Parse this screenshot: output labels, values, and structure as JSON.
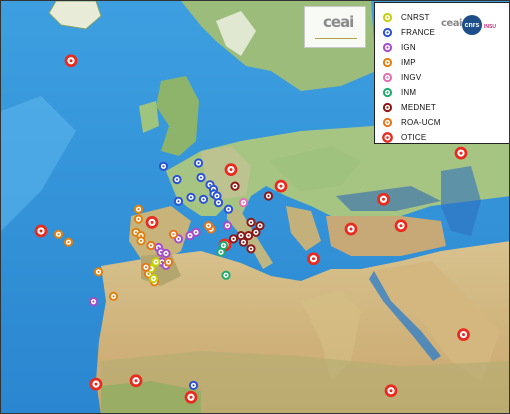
{
  "map_image": {
    "logo": {
      "text": "ceai",
      "subtitle": ""
    },
    "legend": {
      "items": [
        {
          "label": "CNRST",
          "color": "#c6cf0e"
        },
        {
          "label": "FRANCE",
          "color": "#2a52d3"
        },
        {
          "label": "IGN",
          "color": "#a44ccc"
        },
        {
          "label": "IMP",
          "color": "#e0800f"
        },
        {
          "label": "INGV",
          "color": "#e46fb5"
        },
        {
          "label": "INM",
          "color": "#1faa6d"
        },
        {
          "label": "MEDNET",
          "color": "#8c1717"
        },
        {
          "label": "ROA-UCM",
          "color": "#e6761c"
        },
        {
          "label": "OTICE",
          "color": "#e82a1f"
        }
      ],
      "partner_logos": {
        "ceai": "ceai",
        "cnrs": "cnrs",
        "insu": "INSU"
      }
    },
    "stations": [
      {
        "network": "OTICE",
        "lon": -22.0,
        "lat": 64.5
      },
      {
        "network": "OTICE",
        "lon": 10.0,
        "lat": 48.0
      },
      {
        "network": "OTICE",
        "lon": -28.0,
        "lat": 38.7
      },
      {
        "network": "OTICE",
        "lon": -5.8,
        "lat": 40.0
      },
      {
        "network": "OTICE",
        "lon": 8.8,
        "lat": 36.6
      },
      {
        "network": "OTICE",
        "lon": 20.0,
        "lat": 45.5
      },
      {
        "network": "OTICE",
        "lon": 26.5,
        "lat": 34.5
      },
      {
        "network": "OTICE",
        "lon": 40.5,
        "lat": 43.5
      },
      {
        "network": "OTICE",
        "lon": 34.0,
        "lat": 39.0
      },
      {
        "network": "OTICE",
        "lon": 44.0,
        "lat": 39.5
      },
      {
        "network": "OTICE",
        "lon": 56.0,
        "lat": 50.5
      },
      {
        "network": "OTICE",
        "lon": 56.5,
        "lat": 23.0
      },
      {
        "network": "OTICE",
        "lon": 42.0,
        "lat": 14.5
      },
      {
        "network": "OTICE",
        "lon": -17.0,
        "lat": 15.5
      },
      {
        "network": "OTICE",
        "lon": -9.0,
        "lat": 16.0
      },
      {
        "network": "OTICE",
        "lon": 2.0,
        "lat": 13.5
      },
      {
        "network": "FRANCE",
        "lon": -3.5,
        "lat": 48.5
      },
      {
        "network": "FRANCE",
        "lon": 3.5,
        "lat": 49.0
      },
      {
        "network": "FRANCE",
        "lon": -0.8,
        "lat": 46.5
      },
      {
        "network": "FRANCE",
        "lon": 4.0,
        "lat": 46.8
      },
      {
        "network": "FRANCE",
        "lon": 5.8,
        "lat": 45.7
      },
      {
        "network": "FRANCE",
        "lon": 6.5,
        "lat": 45.0
      },
      {
        "network": "FRANCE",
        "lon": 6.6,
        "lat": 44.3
      },
      {
        "network": "FRANCE",
        "lon": 7.2,
        "lat": 44.0
      },
      {
        "network": "FRANCE",
        "lon": 7.5,
        "lat": 43.0
      },
      {
        "network": "FRANCE",
        "lon": 4.5,
        "lat": 43.5
      },
      {
        "network": "FRANCE",
        "lon": 2.0,
        "lat": 43.8
      },
      {
        "network": "FRANCE",
        "lon": -0.5,
        "lat": 43.2
      },
      {
        "network": "FRANCE",
        "lon": 9.5,
        "lat": 42.0
      },
      {
        "network": "FRANCE",
        "lon": 2.5,
        "lat": 15.3
      },
      {
        "network": "IGN",
        "lon": 3.0,
        "lat": 38.5
      },
      {
        "network": "IGN",
        "lon": 1.8,
        "lat": 38.0
      },
      {
        "network": "IGN",
        "lon": -0.5,
        "lat": 37.5
      },
      {
        "network": "IGN",
        "lon": -4.5,
        "lat": 36.2
      },
      {
        "network": "IGN",
        "lon": -4.0,
        "lat": 35.5
      },
      {
        "network": "IGN",
        "lon": -3.0,
        "lat": 35.3
      },
      {
        "network": "IGN",
        "lon": -3.8,
        "lat": 34.0
      },
      {
        "network": "IGN",
        "lon": -3.0,
        "lat": 33.5
      },
      {
        "network": "IGN",
        "lon": -17.5,
        "lat": 28.0
      },
      {
        "network": "IGN",
        "lon": 9.3,
        "lat": 39.5
      },
      {
        "network": "IMP",
        "lon": -8.5,
        "lat": 42.0
      },
      {
        "network": "IMP",
        "lon": -8.5,
        "lat": 40.5
      },
      {
        "network": "IMP",
        "lon": -9.0,
        "lat": 38.5
      },
      {
        "network": "IMP",
        "lon": -8.0,
        "lat": 38.0
      },
      {
        "network": "IMP",
        "lon": -8.0,
        "lat": 37.2
      },
      {
        "network": "IMP",
        "lon": -24.5,
        "lat": 38.2
      },
      {
        "network": "IMP",
        "lon": -22.5,
        "lat": 37.0
      },
      {
        "network": "IMP",
        "lon": -16.5,
        "lat": 32.5
      },
      {
        "network": "IMP",
        "lon": -13.5,
        "lat": 28.8
      },
      {
        "network": "IMP",
        "lon": -6.5,
        "lat": 32.2
      },
      {
        "network": "IMP",
        "lon": -5.3,
        "lat": 31.0
      },
      {
        "network": "INGV",
        "lon": 12.5,
        "lat": 43.0
      },
      {
        "network": "INM",
        "lon": 8.5,
        "lat": 36.5
      },
      {
        "network": "INM",
        "lon": 8.0,
        "lat": 35.5
      },
      {
        "network": "INM",
        "lon": 9.0,
        "lat": 32.0
      },
      {
        "network": "MEDNET",
        "lon": 10.8,
        "lat": 45.5
      },
      {
        "network": "MEDNET",
        "lon": 17.5,
        "lat": 44.0
      },
      {
        "network": "MEDNET",
        "lon": 14.0,
        "lat": 40.0
      },
      {
        "network": "MEDNET",
        "lon": 15.8,
        "lat": 39.5
      },
      {
        "network": "MEDNET",
        "lon": 15.0,
        "lat": 38.5
      },
      {
        "network": "MEDNET",
        "lon": 13.5,
        "lat": 38.0
      },
      {
        "network": "MEDNET",
        "lon": 12.0,
        "lat": 38.0
      },
      {
        "network": "MEDNET",
        "lon": 12.5,
        "lat": 37.0
      },
      {
        "network": "MEDNET",
        "lon": 14.0,
        "lat": 36.0
      },
      {
        "network": "MEDNET",
        "lon": 10.5,
        "lat": 37.5
      },
      {
        "network": "CNRST",
        "lon": -5.0,
        "lat": 34.0
      },
      {
        "network": "CNRST",
        "lon": -6.0,
        "lat": 33.0
      },
      {
        "network": "CNRST",
        "lon": -5.5,
        "lat": 31.5
      },
      {
        "network": "ROA-UCM",
        "lon": -6.0,
        "lat": 36.5
      },
      {
        "network": "ROA-UCM",
        "lon": -1.5,
        "lat": 38.2
      },
      {
        "network": "ROA-UCM",
        "lon": -7.0,
        "lat": 33.2
      },
      {
        "network": "ROA-UCM",
        "lon": -2.5,
        "lat": 34.0
      },
      {
        "network": "ROA-UCM",
        "lon": 6.0,
        "lat": 39.0
      },
      {
        "network": "ROA-UCM",
        "lon": 5.5,
        "lat": 39.5
      }
    ]
  }
}
